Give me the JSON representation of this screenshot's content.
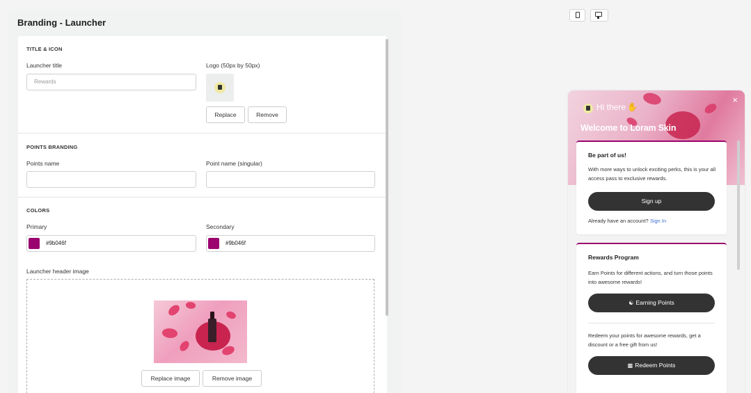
{
  "settings": {
    "title": "Branding - Launcher",
    "title_icon": {
      "heading": "TITLE & ICON",
      "launcher_title_label": "Launcher title",
      "launcher_title_placeholder": "Rewards",
      "logo_label": "Logo (50px by 50px)",
      "replace_label": "Replace",
      "remove_label": "Remove"
    },
    "points_branding": {
      "heading": "POINTS BRANDING",
      "points_name_label": "Points name",
      "point_singular_label": "Point name (singular)"
    },
    "colors": {
      "heading": "COLORS",
      "primary_label": "Primary",
      "primary_value": "#9b046f",
      "secondary_label": "Secondary",
      "secondary_value": "#9b046f",
      "header_image_label": "Launcher header image",
      "replace_image_label": "Replace image",
      "remove_image_label": "Remove image"
    }
  },
  "launcher": {
    "greeting": "Hi there",
    "welcome": "Welcome to Loram Skin",
    "close_glyph": "×",
    "signup_card": {
      "title": "Be part of us!",
      "text": "With more ways to unlock exciting perks, this is your all access pass to exclusive rewards.",
      "button": "Sign up",
      "account_text": "Already have an account?",
      "signin_link": "Sign In"
    },
    "rewards_card": {
      "title": "Rewards Program",
      "earn_text": "Earn Points for different actions, and turn those points into awesome rewards!",
      "earn_button": "Earning Points",
      "redeem_text": "Redeem your points for awesome rewards, get a discount or a free gift from us!",
      "redeem_button": "Redeem Points"
    }
  },
  "theme": {
    "primary": "#9b046f",
    "pill": "#333333",
    "link": "#3f6fd1"
  },
  "icons": [
    "mobile-icon",
    "desktop-icon",
    "logo-icon",
    "wave-icon",
    "close-icon",
    "hands-icon",
    "gift-icon"
  ]
}
